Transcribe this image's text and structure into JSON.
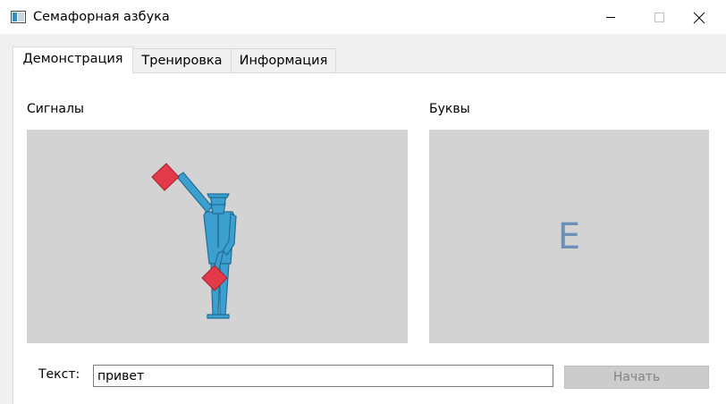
{
  "window": {
    "title": "Семафорная азбука"
  },
  "tabs": [
    {
      "label": "Демонстрация",
      "active": true
    },
    {
      "label": "Тренировка",
      "active": false
    },
    {
      "label": "Информация",
      "active": false
    }
  ],
  "demo": {
    "signals_label": "Сигналы",
    "letters_label": "Буквы",
    "current_letter": "Е",
    "text_label": "Текст:",
    "text_value": "привет",
    "start_button": "Начать"
  },
  "colors": {
    "figure": "#3ba0d0",
    "flag": "#e33a4a",
    "letter": "#6b8fb5",
    "panel_bg": "#d3d3d3"
  },
  "icons": {
    "app": "app-window-icon",
    "minimize": "minimize-icon",
    "maximize": "maximize-icon",
    "close": "close-icon"
  }
}
